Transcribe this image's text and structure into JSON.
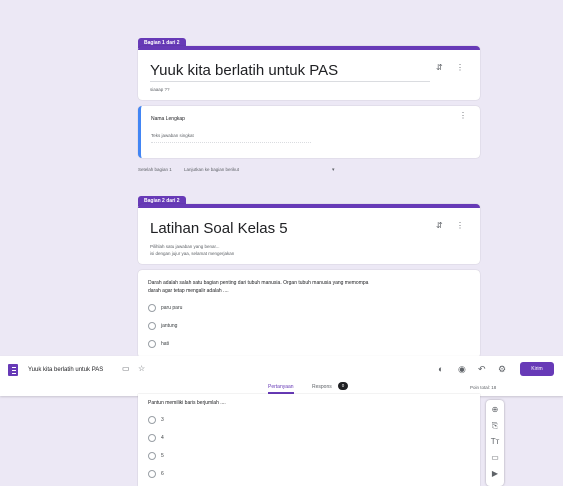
{
  "section1": {
    "tab_label": "Bagian 1 dari 2",
    "title": "Yuuk kita berlatih untuk PAS",
    "description": "siaaap ??"
  },
  "name_question": {
    "label": "Nama Lengkap",
    "placeholder": "Teks jawaban singkat"
  },
  "after_section": {
    "label": "Setelah bagian 1",
    "value": "Lanjutkan ke bagian berikut"
  },
  "section2": {
    "tab_label": "Bagian 2 dari 2",
    "title": "Latihan Soal Kelas 5",
    "description_line1": "Pilihlah satu jawaban yang benar...",
    "description_line2": "isi dengan jujur yaa, selamat mengerjakan"
  },
  "question1": {
    "text_line1": "Darah adalah salah satu bagian penting dari tubuh manusia. Organ tubuh manusia yang memompa",
    "text_line2": "darah agar tetap mengalir adalah ....",
    "options": [
      "paru paru",
      "jantung",
      "hati"
    ]
  },
  "topbar": {
    "form_title": "Yuuk kita berlatih untuk PAS",
    "send_label": "Kirim",
    "tabs": [
      "Pertanyaan",
      "Respons"
    ],
    "response_count": "0",
    "points": "Poin total: 18"
  },
  "question2": {
    "text": "Pantun memiliki baris berjumlah ....",
    "options": [
      "3",
      "4",
      "5",
      "6"
    ]
  },
  "colors": {
    "accent": "#673ab7",
    "background": "#ece8f5",
    "focus": "#4285f4"
  }
}
